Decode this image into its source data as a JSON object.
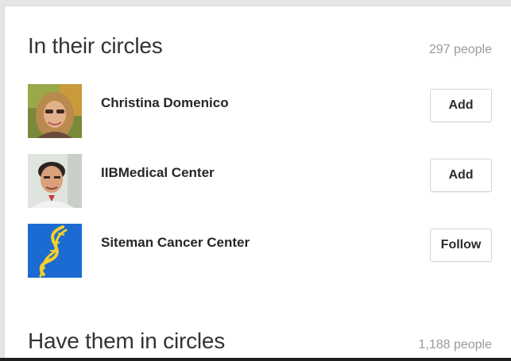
{
  "in_circles": {
    "title": "In their circles",
    "count": "297 people",
    "people": [
      {
        "name": "Christina Domenico",
        "action": "Add",
        "avatar_icon": "woman-photo-avatar-icon"
      },
      {
        "name": "IIBMedical Center",
        "action": "Add",
        "avatar_icon": "man-photo-avatar-icon"
      },
      {
        "name": "Siteman Cancer Center",
        "action": "Follow",
        "avatar_icon": "dna-logo-icon"
      }
    ]
  },
  "have_them": {
    "title": "Have them in circles",
    "count": "1,188 people"
  },
  "colors": {
    "dna_background": "#1b6bd3",
    "dna_strand": "#f4cf2a"
  }
}
